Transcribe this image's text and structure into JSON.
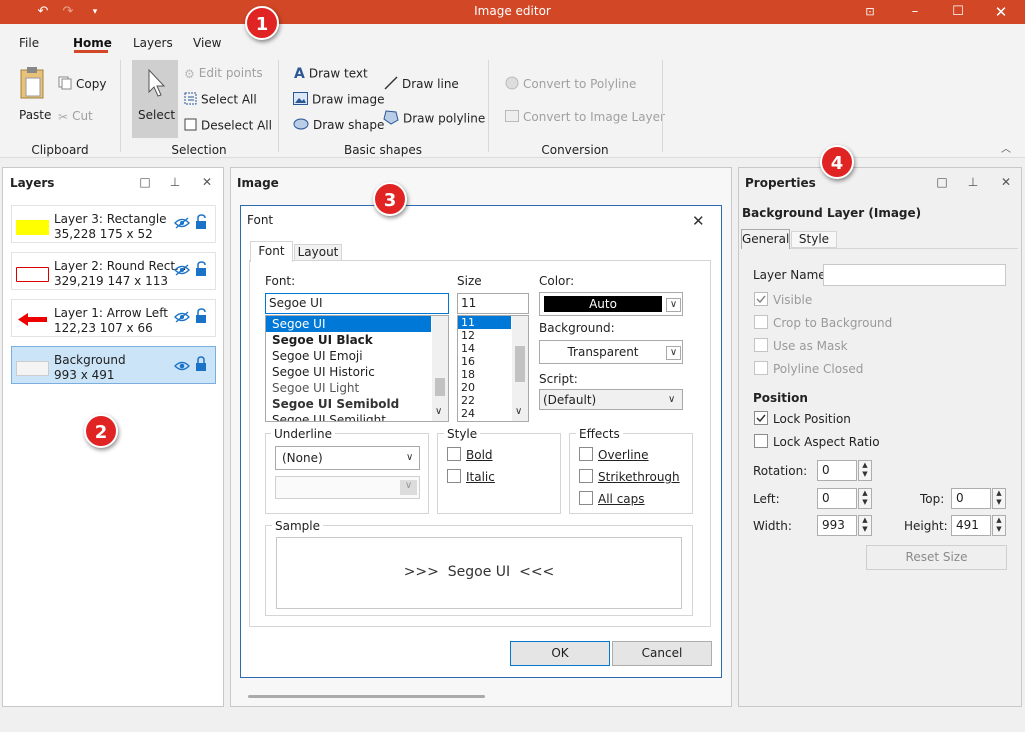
{
  "window": {
    "title": "Image editor"
  },
  "menu": {
    "tabs": [
      "File",
      "Home",
      "Layers",
      "View"
    ],
    "active": "Home"
  },
  "ribbon": {
    "paste": "Paste",
    "copy": "Copy",
    "cut": "Cut",
    "select": "Select",
    "edit_points": "Edit points",
    "select_all": "Select All",
    "deselect_all": "Deselect All",
    "draw_text": "Draw text",
    "draw_image": "Draw image",
    "draw_shape": "Draw shape",
    "draw_line": "Draw line",
    "draw_polyline": "Draw polyline",
    "convert_polyline": "Convert to Polyline",
    "convert_image_layer": "Convert to Image Layer",
    "groups": [
      "Clipboard",
      "Selection",
      "Basic shapes",
      "Conversion"
    ]
  },
  "layers_panel": {
    "title": "Layers",
    "items": [
      {
        "name": "Layer 3: Rectangle",
        "info": "35,228  175 x 52"
      },
      {
        "name": "Layer 2: Round Rect...",
        "info": "329,219  147 x 113"
      },
      {
        "name": "Layer 1: Arrow Left",
        "info": "122,23  107 x 66"
      },
      {
        "name": "Background",
        "info": "993 x 491"
      }
    ]
  },
  "image_panel": {
    "title": "Image"
  },
  "font_dialog": {
    "title": "Font",
    "tabs": [
      "Font",
      "Layout"
    ],
    "font_label": "Font:",
    "font_value": "Segoe UI",
    "fonts": [
      "Segoe UI",
      "Segoe UI Black",
      "Segoe UI Emoji",
      "Segoe UI Historic",
      "Segoe UI Light",
      "Segoe UI Semibold",
      "Segoe UI Semilight"
    ],
    "size_label": "Size",
    "size_value": "11",
    "sizes": [
      "11",
      "12",
      "14",
      "16",
      "18",
      "20",
      "22",
      "24"
    ],
    "color_label": "Color:",
    "color_value": "Auto",
    "background_label": "Background:",
    "background_value": "Transparent",
    "script_label": "Script:",
    "script_value": "(Default)",
    "underline_label": "Underline",
    "underline_value": "(None)",
    "style_label": "Style",
    "bold": "Bold",
    "italic": "Italic",
    "effects_label": "Effects",
    "overline": "Overline",
    "strikethrough": "Strikethrough",
    "allcaps": "All caps",
    "sample_label": "Sample",
    "sample_text": ">>>  Segoe UI  <<<",
    "ok": "OK",
    "cancel": "Cancel"
  },
  "properties": {
    "title": "Properties",
    "heading": "Background Layer (Image)",
    "tabs": [
      "General",
      "Style"
    ],
    "layer_name_label": "Layer Name:",
    "layer_name_value": "",
    "visible": "Visible",
    "crop": "Crop to Background",
    "mask": "Use as Mask",
    "polyline_closed": "Polyline Closed",
    "position_heading": "Position",
    "lock_position": "Lock Position",
    "lock_aspect": "Lock Aspect Ratio",
    "rotation_label": "Rotation:",
    "rotation": "0",
    "left_label": "Left:",
    "left": "0",
    "top_label": "Top:",
    "top": "0",
    "width_label": "Width:",
    "width": "993",
    "height_label": "Height:",
    "height": "491",
    "reset": "Reset Size"
  },
  "badges": [
    "1",
    "2",
    "3",
    "4"
  ],
  "colors": {
    "accent": "#d24726",
    "selection": "#0078d7",
    "badge": "#e02424"
  }
}
